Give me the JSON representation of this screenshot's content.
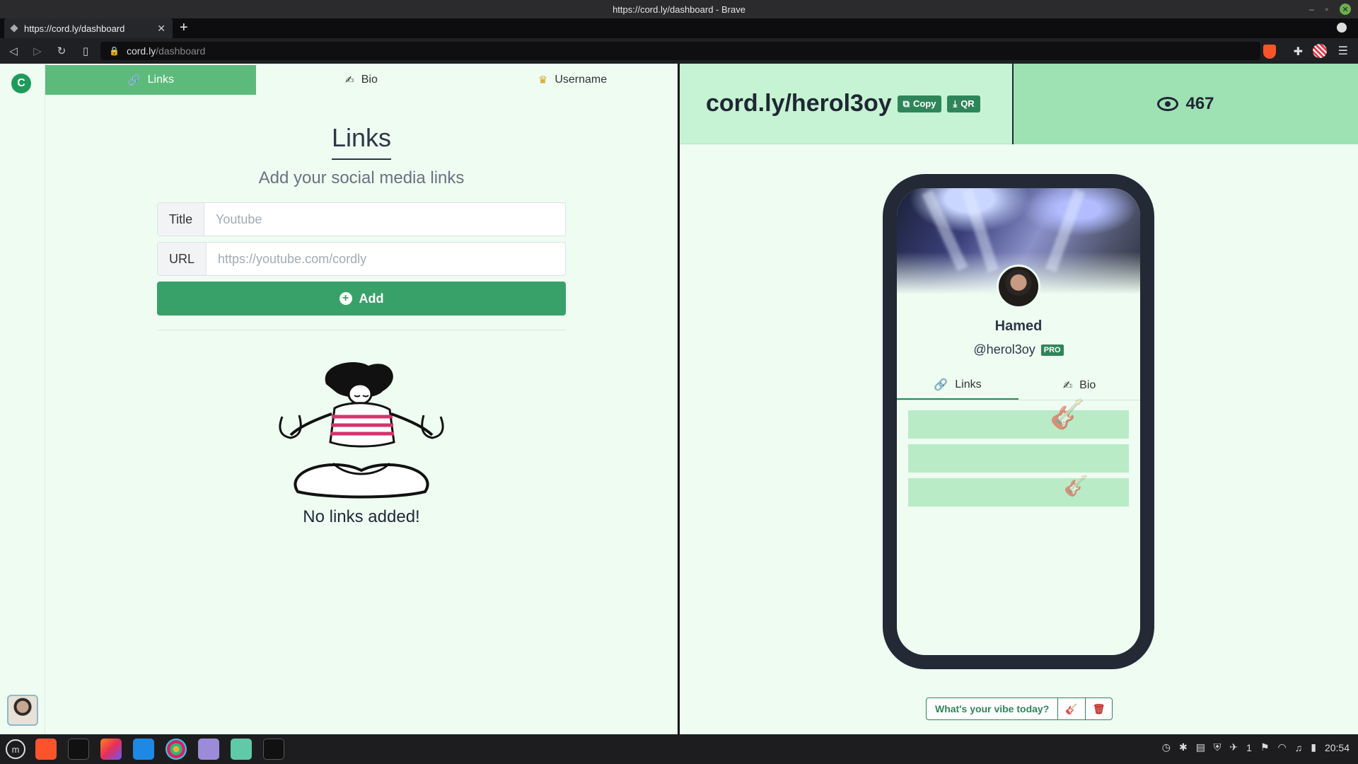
{
  "window": {
    "title": "https://cord.ly/dashboard - Brave"
  },
  "browser": {
    "tab_title": "https://cord.ly/dashboard",
    "url_host": "cord.ly",
    "url_path": "/dashboard"
  },
  "sidebar": {
    "logo_letter": "C"
  },
  "dashboard_tabs": [
    {
      "label": "Links",
      "icon": "link-icon",
      "active": true
    },
    {
      "label": "Bio",
      "icon": "writing-hand-icon",
      "active": false
    },
    {
      "label": "Username",
      "icon": "crown-icon",
      "active": false
    }
  ],
  "editor": {
    "heading": "Links",
    "subheading": "Add your social media links",
    "title_label": "Title",
    "title_placeholder": "Youtube",
    "url_label": "URL",
    "url_placeholder": "https://youtube.com/cordly",
    "add_label": "Add",
    "empty_text": "No links added!"
  },
  "preview_header": {
    "profile_url": "cord.ly/herol3oy",
    "copy_label": "Copy",
    "qr_label": "QR",
    "views": "467"
  },
  "phone_preview": {
    "name": "Hamed",
    "handle": "@herol3oy",
    "badge": "PRO",
    "tabs": [
      {
        "label": "Links",
        "icon": "link-icon"
      },
      {
        "label": "Bio",
        "icon": "writing-hand-icon"
      }
    ]
  },
  "vibe": {
    "label": "What's your vibe today?"
  },
  "tray": {
    "clock": "20:54",
    "battery_count": "1"
  },
  "colors": {
    "accent": "#38a169",
    "tab_active": "#5cbb7b",
    "page_bg": "#eefcf2",
    "views_bg": "#9ee2b4",
    "url_panel_bg": "#c6f3d3"
  }
}
